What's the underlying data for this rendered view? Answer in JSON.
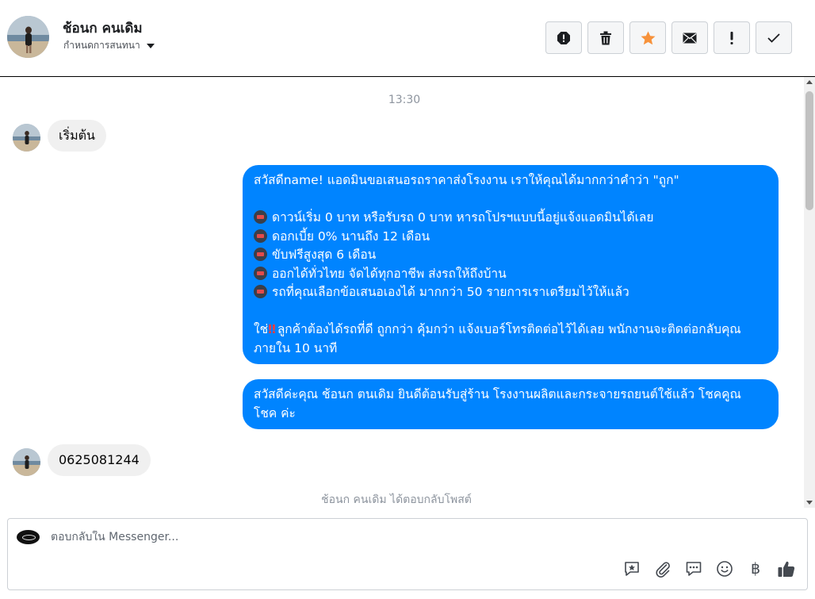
{
  "header": {
    "contact_name": "ช้อนก คนเดิม",
    "assign_label": "กำหนดการสนทนา",
    "actions": [
      {
        "name": "spam-button",
        "icon": "alert-octagon-icon"
      },
      {
        "name": "delete-button",
        "icon": "trash-icon"
      },
      {
        "name": "star-button",
        "icon": "star-icon"
      },
      {
        "name": "mark-unread-button",
        "icon": "envelope-icon"
      },
      {
        "name": "follow-up-button",
        "icon": "exclamation-icon"
      },
      {
        "name": "mark-done-button",
        "icon": "check-icon"
      }
    ],
    "star_color": "#f7923b"
  },
  "chat": {
    "timestamp": "13:30",
    "incoming_1": "เริ่มต้น",
    "outgoing_1": {
      "lines": [
        "สวัสดีname! แอดมินขอเสนอรถราคาส่งโรงงาน เราให้คุณได้มากกว่าคำว่า \"ถูก\"",
        "",
        "ดาวน์เริ่ม 0 บาท หรือรับรถ 0 บาท หารถโปรฯแบบนี้อยู่แจ้งแอดมินได้เลย",
        "ดอกเบี้ย 0% นานถึง 12 เดือน",
        "ขับฟรีสูงสุด 6 เดือน",
        "ออกได้ทั่วไทย จัดได้ทุกอาชีพ ส่งรถให้ถึงบ้าน",
        "รถที่คุณเลือกข้อเสนอเองได้ มากกว่า 50 รายการเราเตรียมไว้ให้แล้ว",
        "",
        "ลูกค้าต้องได้รถที่ดี ถูกกว่า คุ้มกว่า แจ้งเบอร์โทรติดต่อไว้ได้เลย พนักงานจะติดต่อกลับคุณภายใน 10 นาที"
      ],
      "prefix_last": "ใช่",
      "bang": "‼"
    },
    "outgoing_2": "สวัสดีค่ะคุณ ช้อนก ตนเดิม ยินดีต้อนรับสู่ร้าน โรงงานผลิตและกระจายรถยนต์ใช้แล้ว โชคคูณ โชค ค่ะ",
    "incoming_2": "0625081244",
    "system_note": "ช้อนก คนเดิม ได้ตอบกลับโพสต์",
    "bubble_color": "#0084ff"
  },
  "composer": {
    "placeholder": "ตอบกลับใน Messenger...",
    "tools": [
      "saved-reply-icon",
      "paperclip-icon",
      "chat-bubble-icon",
      "smiley-icon",
      "baht-icon",
      "thumbs-up-icon"
    ],
    "baht_symbol": "฿"
  }
}
